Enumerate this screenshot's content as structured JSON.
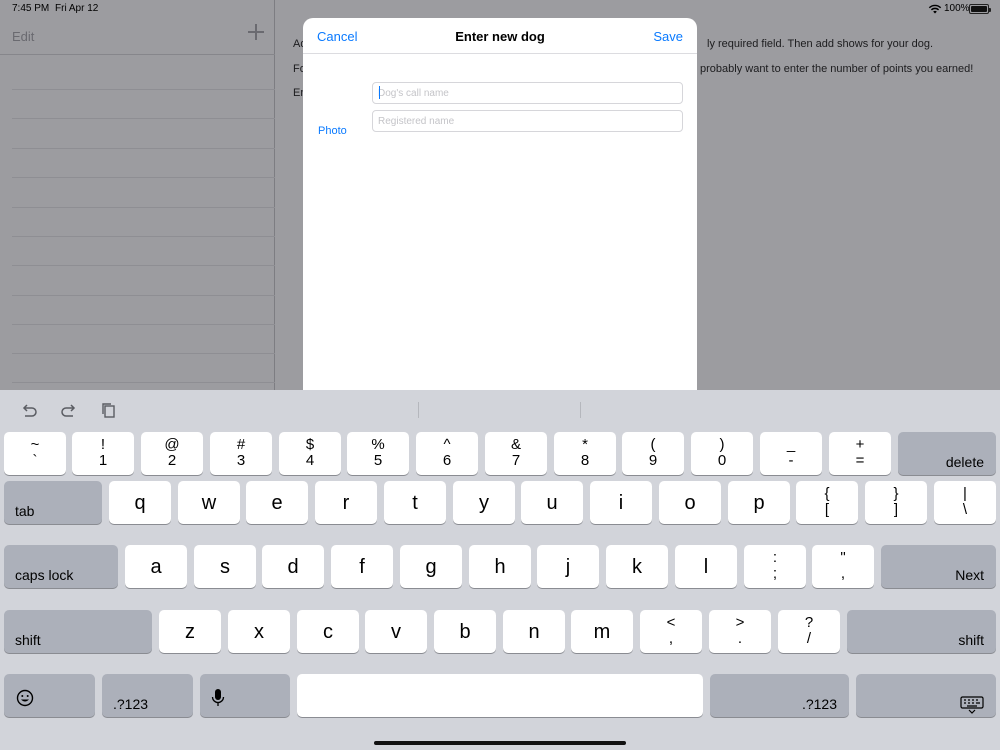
{
  "status_bar": {
    "time": "7:45 PM",
    "date": "Fri Apr 12",
    "battery_percent": "100%",
    "battery_level": 1.0
  },
  "sidebar": {
    "edit_label": "Edit",
    "add_icon": "plus-icon"
  },
  "detail": {
    "line1_prefix": "Ad",
    "line1_suffix": "ly required field. Then add shows for your dog.",
    "line2_prefix": "Fo",
    "line2_suffix": "probably want to enter the number of points you earned!",
    "line3_prefix": "Er"
  },
  "modal": {
    "cancel_label": "Cancel",
    "title": "Enter new dog",
    "save_label": "Save",
    "photo_label": "Photo",
    "call_name_placeholder": "Dog's call name",
    "call_name_value": "",
    "registered_name_placeholder": "Registered name",
    "registered_name_value": ""
  },
  "keyboard": {
    "assistant_icons": [
      "undo-icon",
      "redo-icon",
      "paste-icon"
    ],
    "number_row": [
      {
        "top": "~",
        "bottom": "`"
      },
      {
        "top": "!",
        "bottom": "1"
      },
      {
        "top": "@",
        "bottom": "2"
      },
      {
        "top": "#",
        "bottom": "3"
      },
      {
        "top": "$",
        "bottom": "4"
      },
      {
        "top": "%",
        "bottom": "5"
      },
      {
        "top": "^",
        "bottom": "6"
      },
      {
        "top": "&",
        "bottom": "7"
      },
      {
        "top": "*",
        "bottom": "8"
      },
      {
        "top": "(",
        "bottom": "9"
      },
      {
        "top": ")",
        "bottom": "0"
      },
      {
        "top": "_",
        "bottom": "-"
      },
      {
        "top": "+",
        "bottom": "="
      }
    ],
    "delete_label": "delete",
    "tab_label": "tab",
    "row_q": [
      "q",
      "w",
      "e",
      "r",
      "t",
      "y",
      "u",
      "i",
      "o",
      "p"
    ],
    "row_q_symbols": [
      {
        "top": "{",
        "bottom": "["
      },
      {
        "top": "}",
        "bottom": "]"
      },
      {
        "top": "|",
        "bottom": "\\"
      }
    ],
    "caps_lock_label": "caps lock",
    "row_a": [
      "a",
      "s",
      "d",
      "f",
      "g",
      "h",
      "j",
      "k",
      "l"
    ],
    "row_a_symbols": [
      {
        "top": ":",
        "bottom": ";"
      },
      {
        "top": "\"",
        "bottom": ","
      }
    ],
    "next_label": "Next",
    "shift_label": "shift",
    "row_z": [
      "z",
      "x",
      "c",
      "v",
      "b",
      "n",
      "m"
    ],
    "row_z_symbols": [
      {
        "top": "<",
        "bottom": ","
      },
      {
        "top": ">",
        "bottom": "."
      },
      {
        "top": "?",
        "bottom": "/"
      }
    ],
    "emoji_icon": "emoji-icon",
    "numbers_label": ".?123",
    "mic_icon": "microphone-icon",
    "dismiss_icon": "keyboard-dismiss-icon"
  }
}
